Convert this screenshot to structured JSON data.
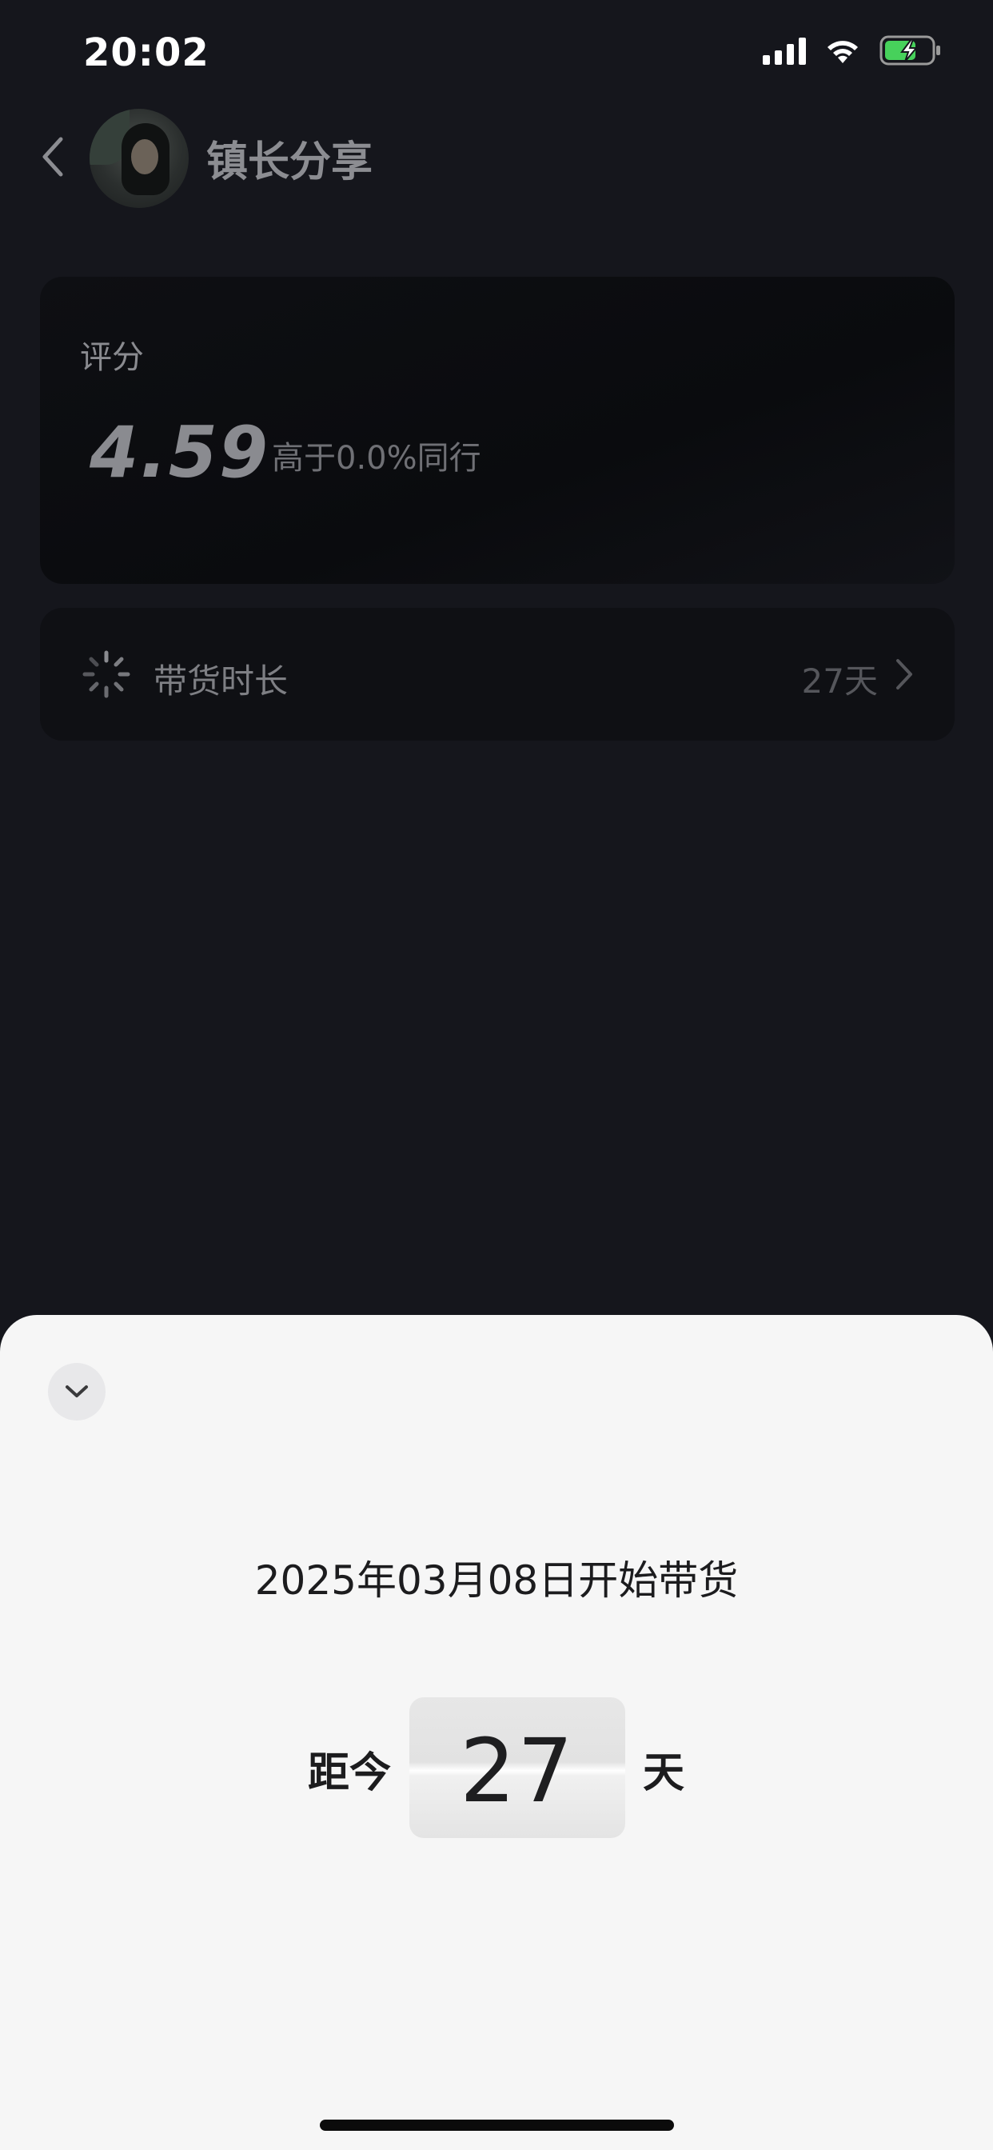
{
  "status_bar": {
    "time": "20:02",
    "icons": [
      "signal-icon",
      "wifi-icon",
      "battery-charging-icon"
    ]
  },
  "header": {
    "title": "镇长分享",
    "icons": [
      "chevron-left-icon",
      "avatar"
    ]
  },
  "rating_card": {
    "label": "评分",
    "value": "4.59",
    "comparison": "高于0.0%同行"
  },
  "duration_row": {
    "label": "带货时长",
    "value": "27天",
    "icons": [
      "loading-spinner-icon",
      "chevron-right-icon"
    ]
  },
  "sheet": {
    "collapse_icon": "chevron-down-icon",
    "title": "2025年03月08日开始带货",
    "days_prefix": "距今",
    "days_number": "27",
    "days_suffix": "天"
  },
  "colors": {
    "background": "#15161c",
    "sheet_background": "#f6f6f6",
    "card_background": "#0e0f13"
  }
}
